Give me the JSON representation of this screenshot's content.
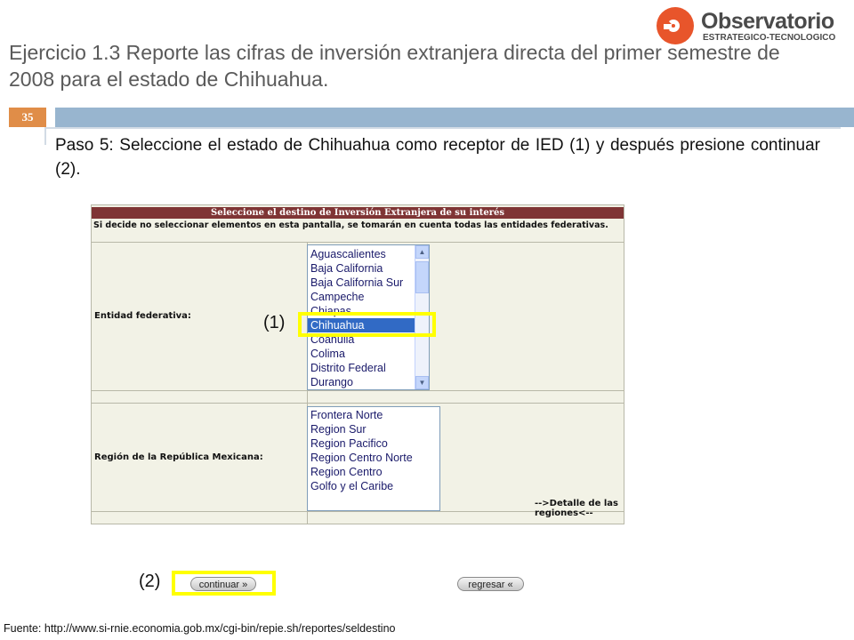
{
  "logo": {
    "name": "Observatorio",
    "subtitle": "ESTRATEGICO-TECNOLOGICO"
  },
  "slide": {
    "title": "Ejercicio 1.3 Reporte las cifras de inversión extranjera directa del primer semestre de 2008 para el estado de Chihuahua.",
    "number": "35",
    "step_text": "Paso 5: Seleccione el estado de Chihuahua como receptor de IED (1) y después presione continuar (2).",
    "source": "Fuente: http://www.si-rnie.economia.gob.mx/cgi-bin/repie.sh/reportes/seldestino"
  },
  "form": {
    "header": "Seleccione el destino de Inversión Extranjera de su interés",
    "note": "Si decide no seleccionar elementos en esta pantalla, se tomarán en cuenta todas las entidades federativas.",
    "entidad_label": "Entidad federativa:",
    "entidades": [
      "Aguascalientes",
      "Baja California",
      "Baja California Sur",
      "Campeche",
      "Chiapas",
      "Chihuahua",
      "Coahuila",
      "Colima",
      "Distrito Federal",
      "Durango"
    ],
    "entidad_selected": "Chihuahua",
    "region_label": "Región de la República Mexicana:",
    "regiones": [
      "Frontera Norte",
      "Region Sur",
      "Region Pacifico",
      "Region Centro Norte",
      "Region Centro",
      "Golfo y el Caribe"
    ],
    "detail_link": "-->Detalle de las regiones<--"
  },
  "callouts": {
    "one": "(1)",
    "two": "(2)"
  },
  "buttons": {
    "continuar": "continuar",
    "regresar": "regresar"
  },
  "colors": {
    "header_bg": "#7f3535",
    "accent_orange": "#e08d48",
    "accent_blue": "#98b5cf",
    "highlight": "#ffff00",
    "selection": "#316ac5"
  }
}
